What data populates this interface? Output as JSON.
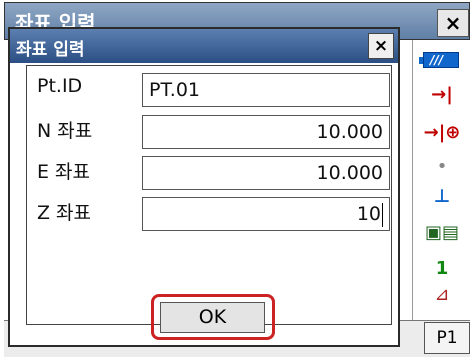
{
  "background_window": {
    "title": "좌표 입력",
    "close_label": "×"
  },
  "statusbar": {
    "battery_label": "///",
    "icons": [
      "→|",
      "→|⊕",
      "•",
      "⊥",
      "▣▤",
      "1",
      "⊿"
    ]
  },
  "bottom": {
    "p1_label": "P1"
  },
  "dialog": {
    "title": "좌표 입력",
    "close_label": "×",
    "fields": [
      {
        "label": "Pt.ID",
        "value": "PT.01",
        "align": "left"
      },
      {
        "label": "N 좌표",
        "value": "10.000",
        "align": "right"
      },
      {
        "label": "E 좌표",
        "value": "10.000",
        "align": "right"
      },
      {
        "label": "Z 좌표",
        "value": "10",
        "align": "right"
      }
    ],
    "ok_label": "OK"
  },
  "colors": {
    "titlebar": "#2b4f84",
    "highlight": "#cc2222",
    "battery": "#1166cc"
  }
}
